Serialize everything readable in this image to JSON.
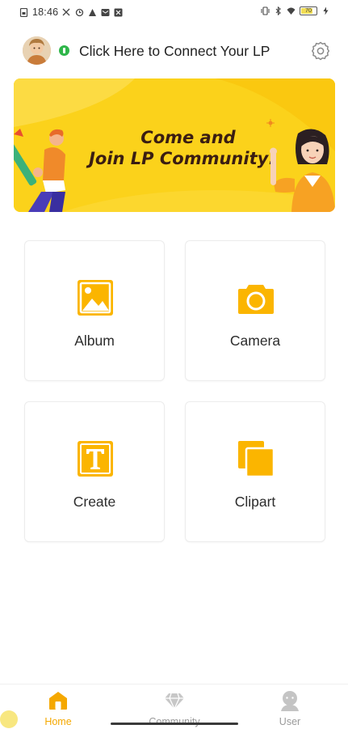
{
  "status_bar": {
    "time": "18:46",
    "battery": "70",
    "left_icons": [
      "sim-icon",
      "signal-off-icon",
      "sync-icon",
      "alert-icon",
      "mail-icon",
      "close-box-icon"
    ],
    "right_icons": [
      "vibrate-icon",
      "bluetooth-icon",
      "wifi-icon",
      "battery-icon",
      "charging-icon"
    ]
  },
  "header": {
    "connect_text": "Click Here to Connect Your LP",
    "avatar_icon": "avatar",
    "settings_icon": "gear-icon"
  },
  "banner": {
    "line1": "Come and",
    "line2": "Join LP Community!",
    "background_color": "#fbd21b",
    "text_color": "#3a1d12"
  },
  "tiles": [
    {
      "label": "Album",
      "icon": "image-icon"
    },
    {
      "label": "Camera",
      "icon": "camera-icon"
    },
    {
      "label": "Create",
      "icon": "text-icon"
    },
    {
      "label": "Clipart",
      "icon": "clipart-icon"
    }
  ],
  "bottom_nav": {
    "items": [
      {
        "label": "Home",
        "icon": "home-icon",
        "active": true
      },
      {
        "label": "Community",
        "icon": "diamond-icon",
        "active": false
      },
      {
        "label": "User",
        "icon": "user-icon",
        "active": false
      }
    ],
    "active_color": "#f5a800",
    "inactive_color": "#9a9a9a"
  },
  "colors": {
    "accent": "#fbb500",
    "connected_dot": "#2fb64a"
  }
}
